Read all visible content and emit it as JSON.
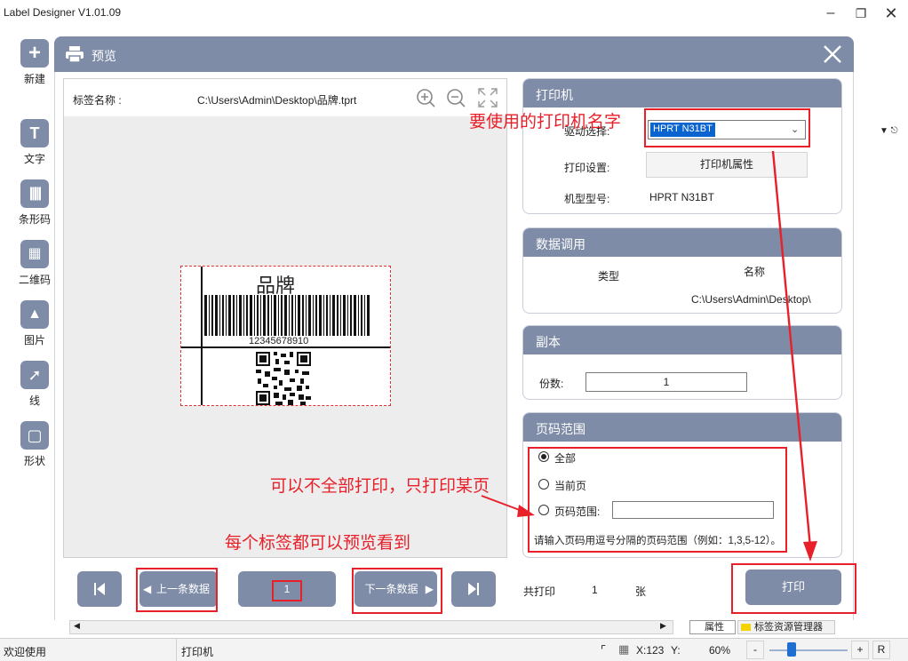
{
  "app": {
    "title": "Label Designer V1.01.09"
  },
  "toolbar": [
    {
      "label": "新建",
      "icon": "plus-icon"
    },
    {
      "label": "文字",
      "icon": "text-icon"
    },
    {
      "label": "条形码",
      "icon": "barcode-icon"
    },
    {
      "label": "二维码",
      "icon": "qrcode-icon"
    },
    {
      "label": "图片",
      "icon": "image-icon"
    },
    {
      "label": "线",
      "icon": "line-icon"
    },
    {
      "label": "形状",
      "icon": "shape-icon"
    }
  ],
  "dialog": {
    "title": "预览",
    "label_name_caption": "标签名称 :",
    "label_path": "C:\\Users\\Admin\\Desktop\\品牌.tprt",
    "label_preview": {
      "title": "品牌",
      "barcode_text": "12345678910"
    }
  },
  "printer": {
    "header": "打印机",
    "driver_label": "驱动选择:",
    "driver_value": "HPRT N31BT",
    "settings_label": "打印设置:",
    "properties_button": "打印机属性",
    "model_label": "机型型号:",
    "model_value": "HPRT N31BT"
  },
  "data_source": {
    "header": "数据调用",
    "col_type": "类型",
    "col_name": "名称",
    "path": "C:\\Users\\Admin\\Desktop\\"
  },
  "copies": {
    "header": "副本",
    "label": "份数:",
    "value": "1"
  },
  "page_range": {
    "header": "页码范围",
    "options": [
      "全部",
      "当前页",
      "页码范围:"
    ],
    "selected": 0,
    "hint": "请输入页码用逗号分隔的页码范围（例如：1,3,5-12）。"
  },
  "nav": {
    "prev": "上一条数据",
    "next": "下一条数据",
    "page": "1",
    "total_prefix": "共打印",
    "total_value": "1",
    "total_suffix": "张",
    "print": "打印"
  },
  "annotations": {
    "printer_name": "要使用的打印机名字",
    "partial_print": "可以不全部打印，只打印某页",
    "preview_each": "每个标签都可以预览看到"
  },
  "bottom_tabs": [
    "属性",
    "标签资源管理器"
  ],
  "status": {
    "welcome": "欢迎使用",
    "printer": "打印机",
    "x": "X:123",
    "y": "Y:",
    "zoom": "60%",
    "minus": "-",
    "plus": "+",
    "reset": "R"
  },
  "colors": {
    "accent": "#7e8ca8",
    "annotation": "#e8202a"
  }
}
